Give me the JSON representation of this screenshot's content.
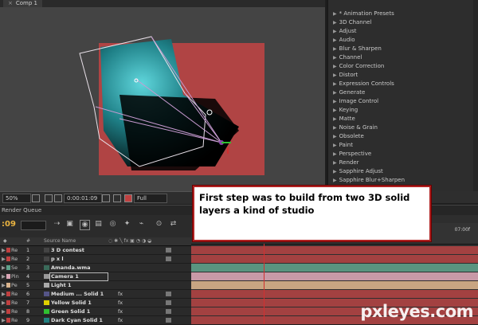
{
  "colors": {
    "accent_timecode": "#e9b340",
    "solid_red": "#b04444",
    "callout_border": "#b02020"
  },
  "comp_panel": {
    "tab_close": "×",
    "tab_label": "Comp 1"
  },
  "comp_footer": {
    "zoom": "50%",
    "timecode": "0:00:01:09",
    "resolution": "Full"
  },
  "effects_panel": {
    "items": [
      "* Animation Presets",
      "3D Channel",
      "Adjust",
      "Audio",
      "Blur & Sharpen",
      "Channel",
      "Color Correction",
      "Distort",
      "Expression Controls",
      "Generate",
      "Image Control",
      "Keying",
      "Matte",
      "Noise & Grain",
      "Obsolete",
      "Paint",
      "Perspective",
      "Render",
      "Sapphire Adjust",
      "Sapphire Blur+Sharpen"
    ]
  },
  "timeline": {
    "tab_label": "Render Queue",
    "timecode": ":09",
    "ruler_label": "07:00f",
    "col_source_name": "Source Name",
    "col_hash": "#",
    "layers": [
      {
        "label": "Re",
        "num": "1",
        "name": "3 D contest",
        "label_color": "#c04040",
        "swatch": "#444444",
        "fx": ""
      },
      {
        "label": "Re",
        "num": "2",
        "name": "p x l",
        "label_color": "#c04040",
        "swatch": "#444444",
        "fx": ""
      },
      {
        "label": "Se",
        "num": "3",
        "name": "Amanda.wma",
        "label_color": "#5fa08a",
        "swatch": "#3a6b5a",
        "fx": ""
      },
      {
        "label": "Pin",
        "num": "4",
        "name": "Camera 1",
        "label_color": "#d9a5b5",
        "swatch": "#999999",
        "fx": ""
      },
      {
        "label": "Pe",
        "num": "5",
        "name": "Light 1",
        "label_color": "#d9b38c",
        "swatch": "#aaaaaa",
        "fx": ""
      },
      {
        "label": "Re",
        "num": "6",
        "name": "Medium ... Solid 1",
        "label_color": "#c04040",
        "swatch": "#555588",
        "fx": "fx"
      },
      {
        "label": "Re",
        "num": "7",
        "name": "Yellow Solid 1",
        "label_color": "#c04040",
        "swatch": "#e0d000",
        "fx": "fx"
      },
      {
        "label": "Re",
        "num": "8",
        "name": "Green Solid 1",
        "label_color": "#c04040",
        "swatch": "#30c030",
        "fx": "fx"
      },
      {
        "label": "Re",
        "num": "9",
        "name": "Dark Cyan Solid 1",
        "label_color": "#c04040",
        "swatch": "#208080",
        "fx": "fx"
      }
    ]
  },
  "annotation": {
    "text": "First step was to build from two 3D solid layers a kind of studio"
  },
  "watermark": "pxleyes.com"
}
